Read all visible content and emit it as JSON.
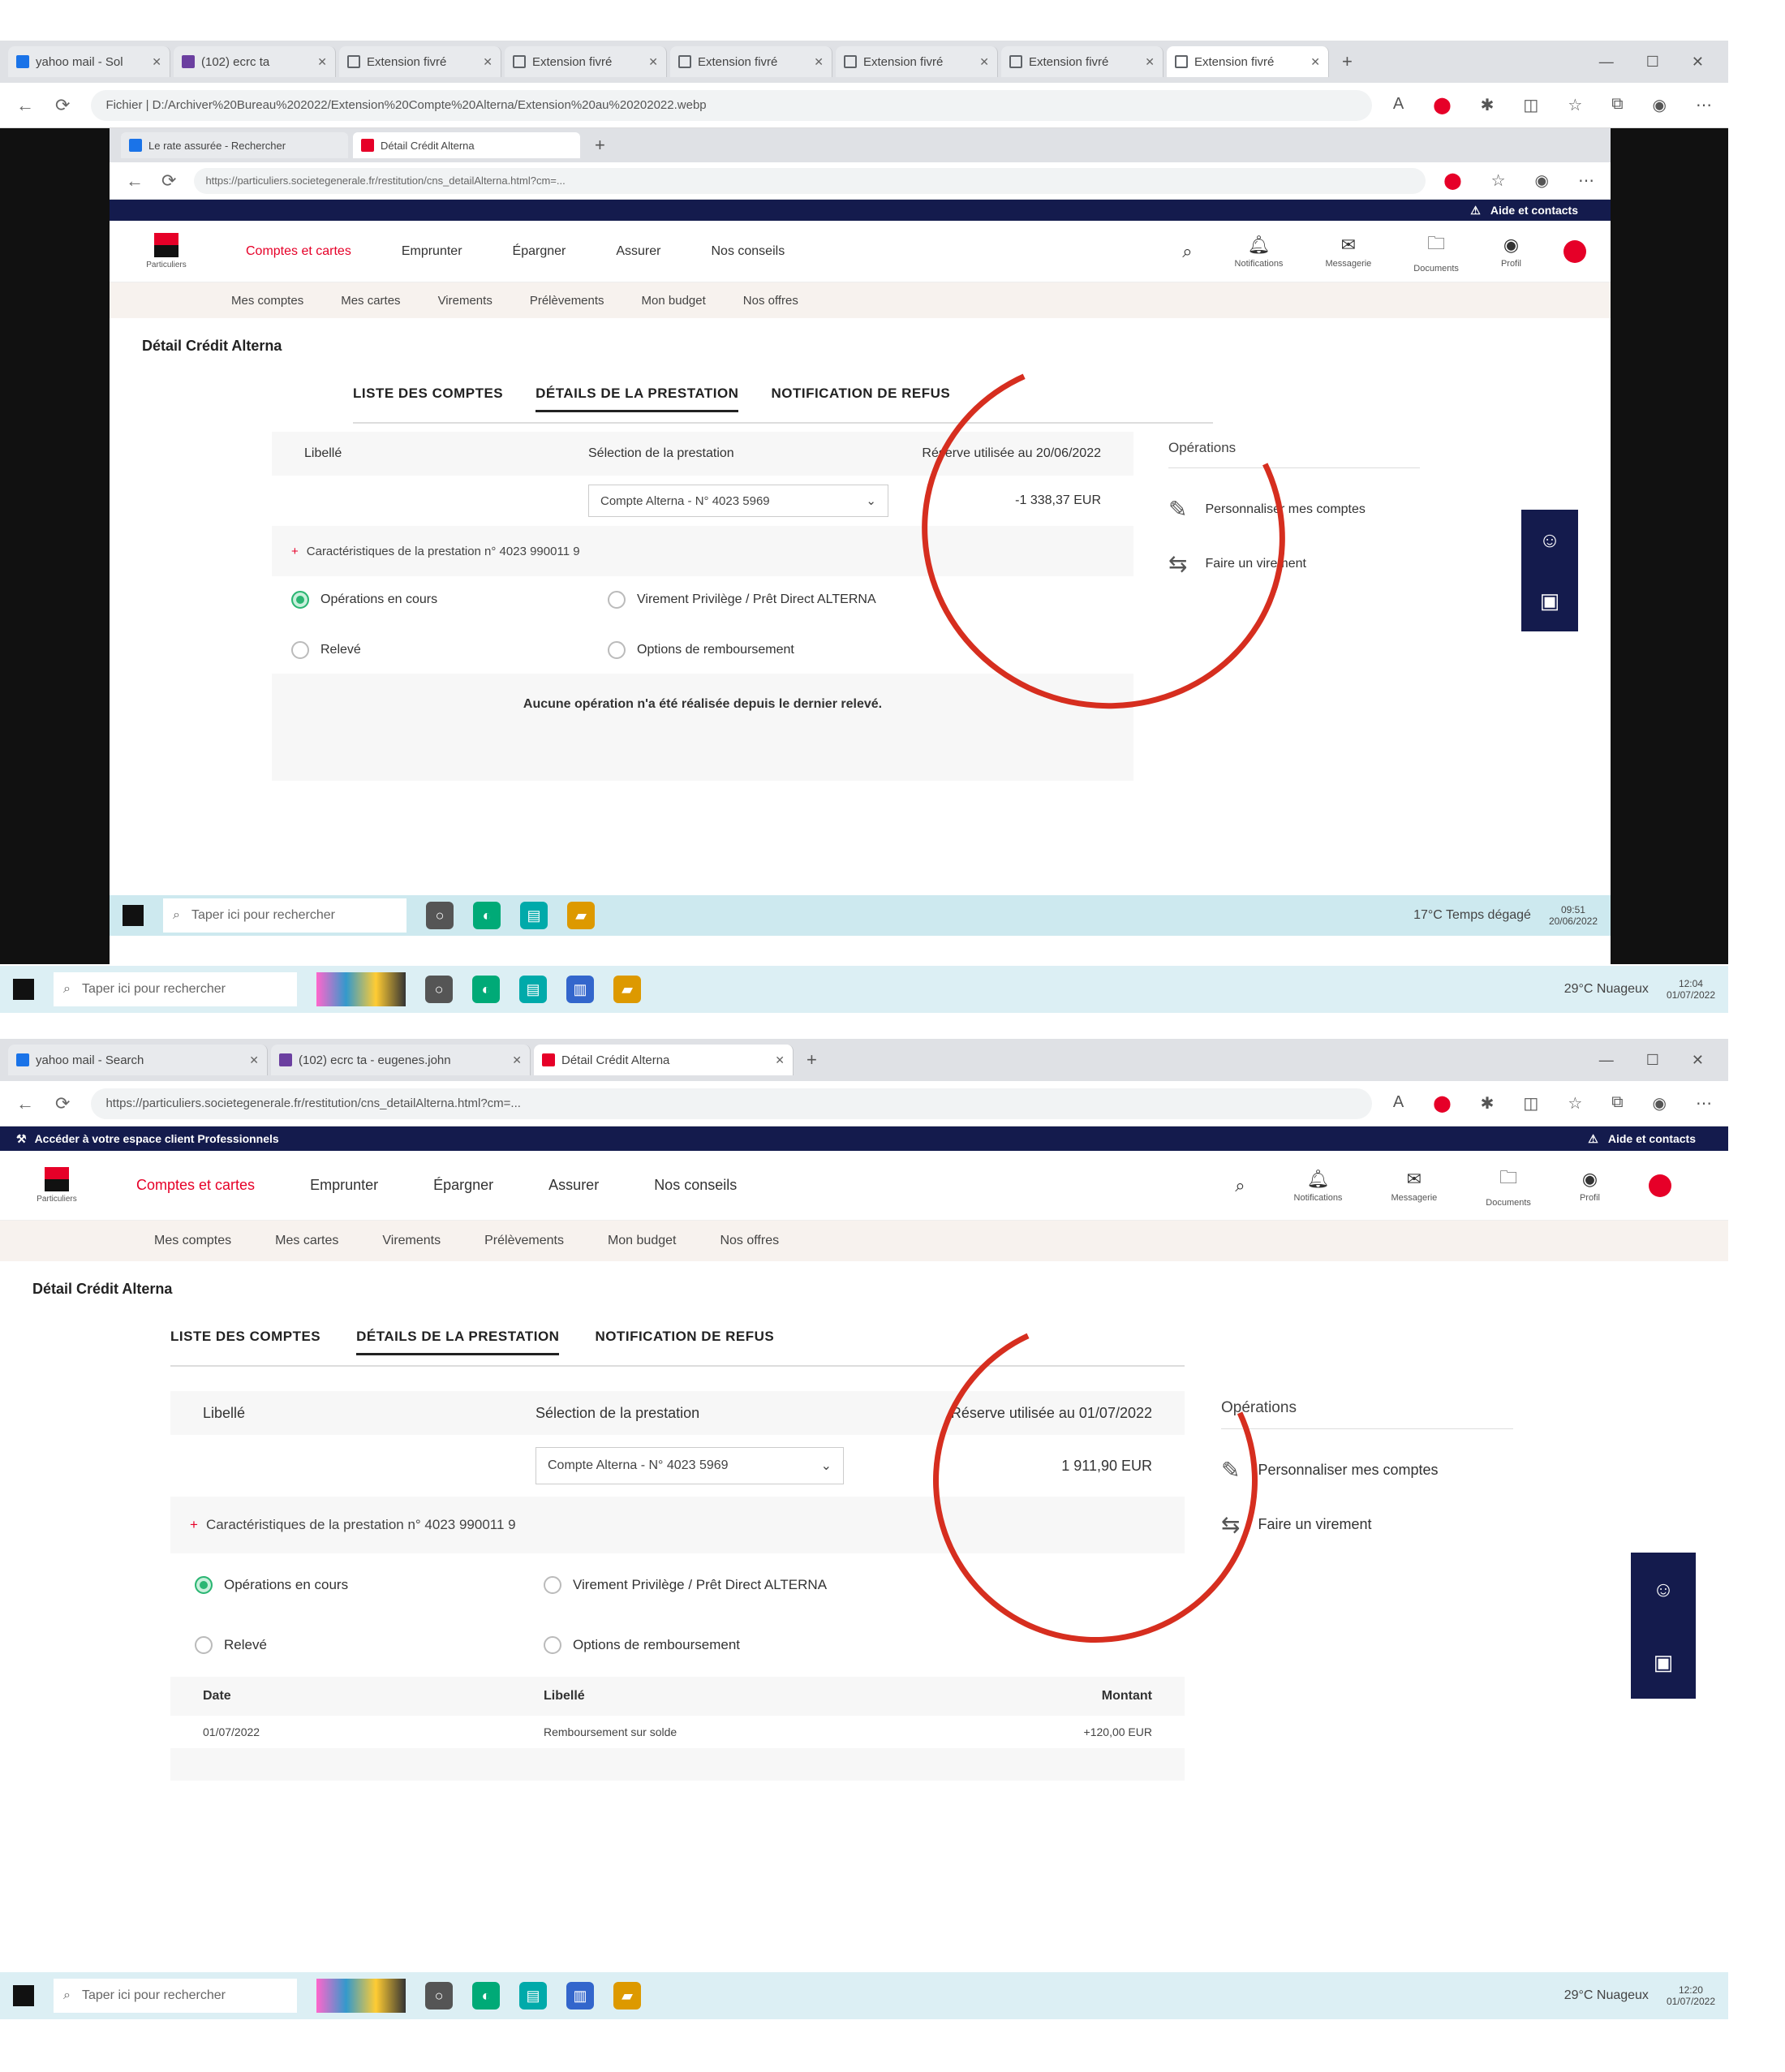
{
  "outer_tabs_1": [
    "yahoo mail - Sol",
    "(102) ecrc ta",
    "Extension fivré",
    "Extension fivré",
    "Extension fivré",
    "Extension fivré",
    "Extension fivré",
    "Extension fivré"
  ],
  "outer_url_1": "Fichier | D:/Archiver%20Bureau%202022/Extension%20Compte%20Alterna/Extension%20au%20202022.webp",
  "inner_tabs_1": [
    "Le rate assurée - Rechercher",
    "Détail Crédit Alterna"
  ],
  "inner_url_1": "https://particuliers.societegenerale.fr/restitution/cns_detailAlterna.html?cm=...",
  "outer_tabs_2": [
    "yahoo mail - Search",
    "(102) ecrc ta - eugenes.john",
    "Détail Crédit Alterna"
  ],
  "outer_url_2": "https://particuliers.societegenerale.fr/restitution/cns_detailAlterna.html?cm=...",
  "site": {
    "top_banner_left": "Accéder à votre espace client Professionnels",
    "top_banner_right": "Aide et contacts",
    "logo_text": "Particuliers",
    "nav": [
      "Comptes et cartes",
      "Emprunter",
      "Épargner",
      "Assurer",
      "Nos conseils"
    ],
    "header_icons": [
      "Notifications",
      "Messagerie",
      "Documents",
      "Profil"
    ],
    "subnav": [
      "Mes comptes",
      "Mes cartes",
      "Virements",
      "Prélèvements",
      "Mon budget",
      "Nos offres"
    ],
    "page_title": "Détail Crédit Alterna",
    "tabs": [
      "LISTE DES COMPTES",
      "DÉTAILS DE LA PRESTATION",
      "NOTIFICATION DE REFUS"
    ],
    "col_libelle": "Libellé",
    "col_selection": "Sélection de la prestation",
    "select_value": "Compte Alterna - N° 4023 5969",
    "characteristics": "Caractéristiques de la prestation n° 4023 990011 9",
    "radios": [
      "Opérations en cours",
      "Virement Privilège / Prêt Direct ALTERNA",
      "Relevé",
      "Options de remboursement"
    ],
    "operations_title": "Opérations",
    "op_customize": "Personnaliser mes comptes",
    "op_transfer": "Faire un virement"
  },
  "shot1": {
    "reserve_label": "Réserve utilisée au 20/06/2022",
    "reserve_value": "-1 338,37 EUR",
    "empty_note": "Aucune opération n'a été réalisée depuis le dernier relevé."
  },
  "shot2": {
    "reserve_label": "Réserve utilisée au 01/07/2022",
    "reserve_value": "1 911,90 EUR",
    "table_cols": [
      "Date",
      "Libellé",
      "Montant"
    ],
    "row_date": "01/07/2022",
    "row_label": "Remboursement sur solde",
    "row_amount": "+120,00 EUR"
  },
  "taskbar": {
    "search_placeholder": "Taper ici pour rechercher",
    "weather_inner": "17°C Temps dégagé",
    "weather_outer": "29°C Nuageux",
    "time_inner": "09:51",
    "date_inner": "20/06/2022",
    "time_outer_1": "12:04",
    "date_outer_1": "01/07/2022",
    "time_outer_2": "12:20",
    "date_outer_2": "01/07/2022"
  },
  "colors": {
    "brand_red": "#e60028",
    "navy": "#141b4d",
    "annotation_red": "#d62e1f"
  }
}
